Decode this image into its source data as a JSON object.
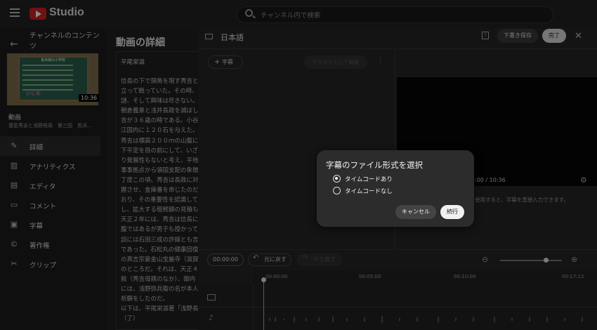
{
  "topbar": {
    "app_name": "Studio",
    "search_placeholder": "チャンネル内で検索"
  },
  "sidebar": {
    "channel_title": "チャンネルのコンテンツ",
    "thumbnail": {
      "caption": "長浜城の小学校",
      "duration": "10:36",
      "board_word": "いじめ"
    },
    "video_label": "動画",
    "video_subtitle": "豊臣秀吉と浅野長政　第三回　長浜...",
    "items": [
      {
        "label": "詳細",
        "icon": "pencil-icon"
      },
      {
        "label": "アナリティクス",
        "icon": "analytics-icon"
      },
      {
        "label": "エディタ",
        "icon": "film-icon"
      },
      {
        "label": "コメント",
        "icon": "comment-icon"
      },
      {
        "label": "字幕",
        "icon": "subtitles-icon"
      },
      {
        "label": "著作権",
        "icon": "copyright-icon"
      },
      {
        "label": "クリップ",
        "icon": "scissors-icon"
      }
    ]
  },
  "details": {
    "heading": "動画の詳細",
    "author": "平尾栄滋",
    "body": "信長の下で頭角を現す秀吉と\n立って戦っていた。その時、\n謎、そして興味は尽きない。\n朝倉義景と浅井長政を滅ぼし\n吉が３６歳の時である。小谷\n江国内に１２０石を与えた。\n秀吉は標高２００ｍの山腹に\n下平定を目の前にして、いざ\nり発展性もないと考え、平地\n事事拠点から領国支配の象徴\n丁度この頃、秀吉は長政に対\n握させ、金庫番を命じたのだ\nおり、その重要性を認識して\nし、拡大する租税額の見積も\n天正２年には、秀吉は信長に\n腹ではあるが男子も授かって\n説には石田三成の許嫁とも言\nであった。石松丸の健康回復\nの真言宗豪金山宝厳寺（滋賀\nのところだ。それは、天正４\n殺（秀吉母親のなか）、御内\nには、浅野弥兵衛の名が本人\n祈願をしたのだ。\n以下は、平尾栄滋著「浅野長\n（了）"
  },
  "editor": {
    "language": "日本語",
    "draft_label": "下書き保存",
    "done_label": "完了",
    "add_caption_label": "字幕",
    "edit_as_text_label": "テキストとして編集",
    "time_readout": ":00 / 10:36",
    "player_hint": "使用すると、字幕を直接入力できます。",
    "timecode": "00:00:00",
    "undo_label": "元に戻す",
    "redo_label": "やり直す",
    "ruler_ticks": [
      "00:00:00",
      "00:05:00",
      "00:10:00",
      "00:17:12"
    ]
  },
  "dialog": {
    "title": "字幕のファイル形式を選択",
    "options": [
      {
        "label": "タイムコードあり",
        "selected": true
      },
      {
        "label": "タイムコードなし",
        "selected": false
      }
    ],
    "cancel_label": "キャンセル",
    "continue_label": "続行"
  }
}
